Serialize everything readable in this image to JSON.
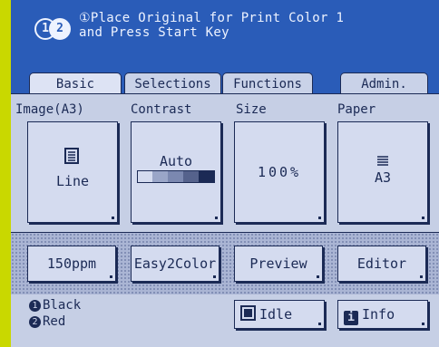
{
  "header": {
    "ink_icons": [
      "1",
      "2"
    ],
    "message_line1": "①Place Original for Print Color 1",
    "message_line2": "and Press Start Key"
  },
  "tabs": [
    {
      "label": "Basic",
      "active": true
    },
    {
      "label": "Selections",
      "active": false
    },
    {
      "label": "Functions",
      "active": false
    },
    {
      "label": "Admin.",
      "active": false
    }
  ],
  "basic": {
    "image_label": "Image(A3)",
    "image_value": "Line",
    "contrast_label": "Contrast",
    "contrast_value": "Auto",
    "size_label": "Size",
    "size_value": "100%",
    "paper_label": "Paper",
    "paper_value": "A3"
  },
  "quick": {
    "speed": "150ppm",
    "easy2color": "Easy2Color",
    "preview": "Preview",
    "editor": "Editor"
  },
  "footer": {
    "ink1": "Black",
    "ink1_num": "1",
    "ink2": "Red",
    "ink2_num": "2",
    "status": "Idle",
    "info": "Info"
  },
  "colors": {
    "screen_bg": "#2a5cb8",
    "panel_bg": "#c6cfe5",
    "ink": "#1b2a55",
    "bezel": "#c9d800"
  }
}
